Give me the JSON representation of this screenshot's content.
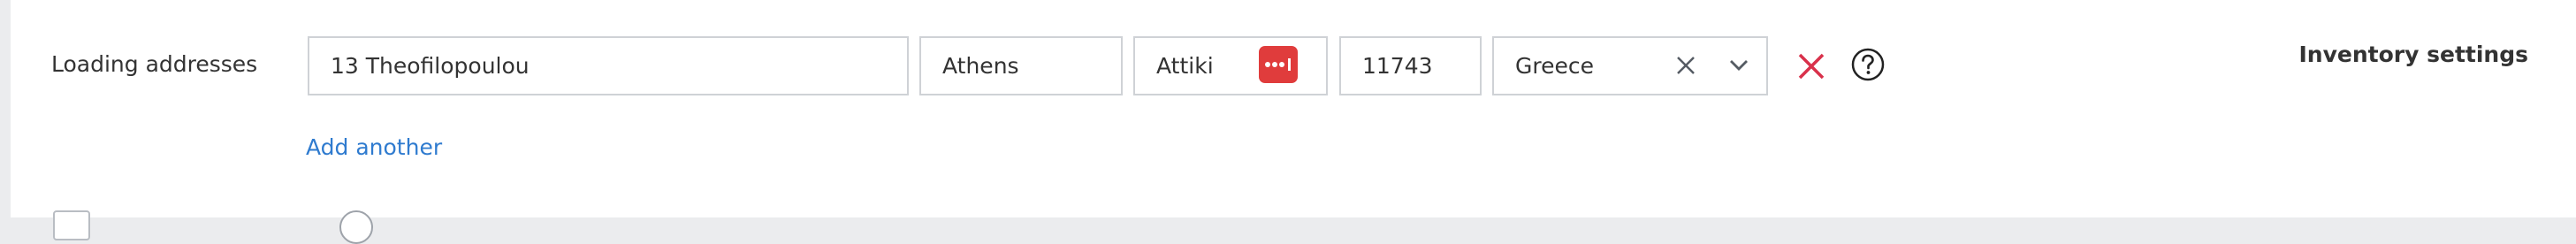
{
  "loading_addresses": {
    "label": "Loading addresses",
    "street": "13 Theofilopoulou",
    "city": "Athens",
    "region": "Attiki",
    "postal_code": "11743",
    "country": "Greece",
    "add_another_label": "Add another"
  },
  "header": {
    "inventory_settings_label": "Inventory settings"
  },
  "icons": {
    "password_manager": "password-manager-icon",
    "clear": "close-icon",
    "dropdown": "chevron-down-icon",
    "remove": "close-icon",
    "help": "question-circle-icon"
  },
  "colors": {
    "link": "#2f7bcf",
    "remove": "#d9314b",
    "badge": "#e03c3c",
    "border": "#cfd2d6"
  }
}
